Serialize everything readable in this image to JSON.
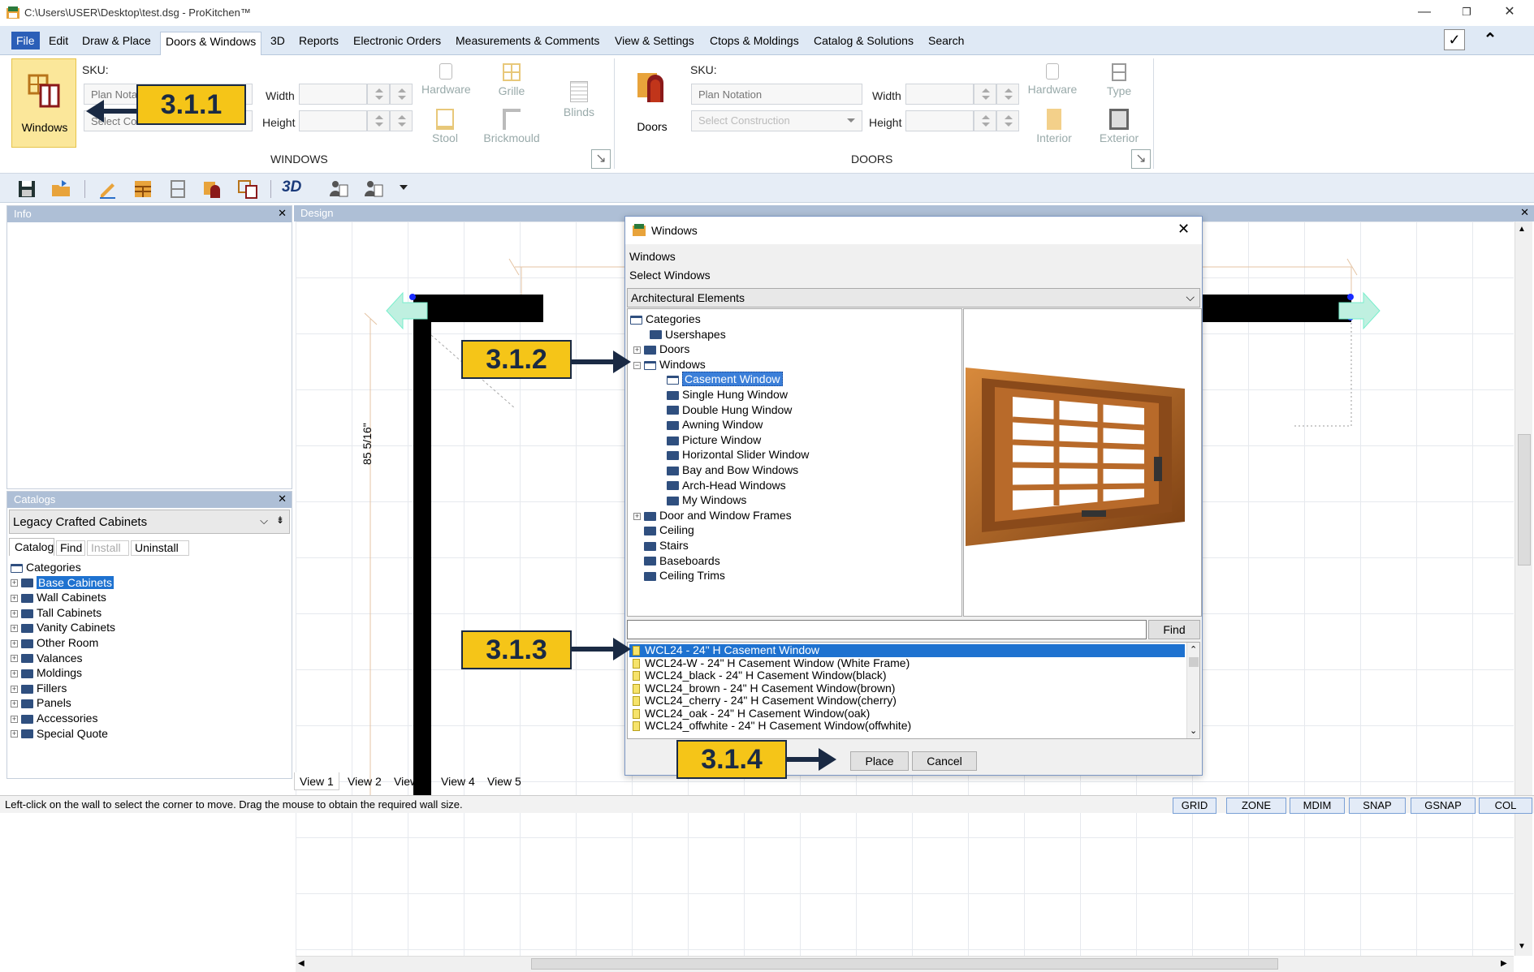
{
  "window": {
    "title": "C:\\Users\\USER\\Desktop\\test.dsg - ProKitchen™"
  },
  "menu": [
    "File",
    "Edit",
    "Draw & Place",
    "Doors & Windows",
    "3D",
    "Reports",
    "Electronic Orders",
    "Measurements & Comments",
    "View & Settings",
    "Ctops & Moldings",
    "Catalog & Solutions",
    "Search"
  ],
  "ribbon": {
    "windows": {
      "button": "Windows",
      "sku": "SKU:",
      "notation_placeholder": "Plan Notation",
      "construction_placeholder": "Select Construction",
      "width": "Width",
      "height": "Height",
      "hardware": "Hardware",
      "grille": "Grille",
      "blinds": "Blinds",
      "stool": "Stool",
      "brickmould": "Brickmould",
      "group": "WINDOWS"
    },
    "doors": {
      "button": "Doors",
      "sku": "SKU:",
      "notation_placeholder": "Plan Notation",
      "construction_placeholder": "Select Construction",
      "width": "Width",
      "height": "Height",
      "hardware": "Hardware",
      "type": "Type",
      "interior": "Interior",
      "exterior": "Exterior",
      "group": "DOORS"
    }
  },
  "callouts": {
    "c1": "3.1.1",
    "c2": "3.1.2",
    "c3": "3.1.3",
    "c4": "3.1.4"
  },
  "info_panel": {
    "title": "Info"
  },
  "catalogs_panel": {
    "title": "Catalogs",
    "selected_catalog": "Legacy Crafted Cabinets",
    "tabs": [
      "Catalog",
      "Find",
      "Install",
      "Uninstall"
    ],
    "root": "Categories",
    "items": [
      "Base Cabinets",
      "Wall Cabinets",
      "Tall Cabinets",
      "Vanity Cabinets",
      "Other Room",
      "Valances",
      "Moldings",
      "Fillers",
      "Panels",
      "Accessories",
      "Special Quote"
    ]
  },
  "design": {
    "title": "Design",
    "dimension": "85 5/16\"",
    "view_tabs": [
      "View 1",
      "View 2",
      "View 3",
      "View 4",
      "View 5"
    ]
  },
  "dialog": {
    "title": "Windows",
    "heading": "Windows",
    "subheading": "Select Windows",
    "category_select": "Architectural Elements",
    "tree_root": "Categories",
    "tree_top": [
      "Usershapes",
      "Doors"
    ],
    "tree_windows": "Windows",
    "tree_windows_children": [
      "Casement Window",
      "Single Hung Window",
      "Double Hung Window",
      "Awning Window",
      "Picture Window",
      "Horizontal Slider Window",
      "Bay and Bow Windows",
      "Arch-Head Windows",
      "My Windows"
    ],
    "tree_bottom": [
      "Door and Window Frames",
      "Ceiling",
      "Stairs",
      "Baseboards",
      "Ceiling Trims"
    ],
    "find_button": "Find",
    "search_value": "",
    "results": [
      "WCL24 - 24\" H Casement Window",
      "WCL24-W - 24\" H Casement Window (White Frame)",
      "WCL24_black - 24\" H Casement Window(black)",
      "WCL24_brown - 24\" H Casement Window(brown)",
      "WCL24_cherry - 24\" H Casement Window(cherry)",
      "WCL24_oak - 24\" H Casement Window(oak)",
      "WCL24_offwhite - 24\" H Casement Window(offwhite)"
    ],
    "place_button": "Place",
    "cancel_button": "Cancel"
  },
  "status": {
    "message": "Left-click on the wall to select the corner to move. Drag the mouse to obtain the required wall size.",
    "toggles": [
      "GRID",
      "ZONE",
      "MDIM",
      "SNAP",
      "GSNAP",
      "COL"
    ]
  }
}
